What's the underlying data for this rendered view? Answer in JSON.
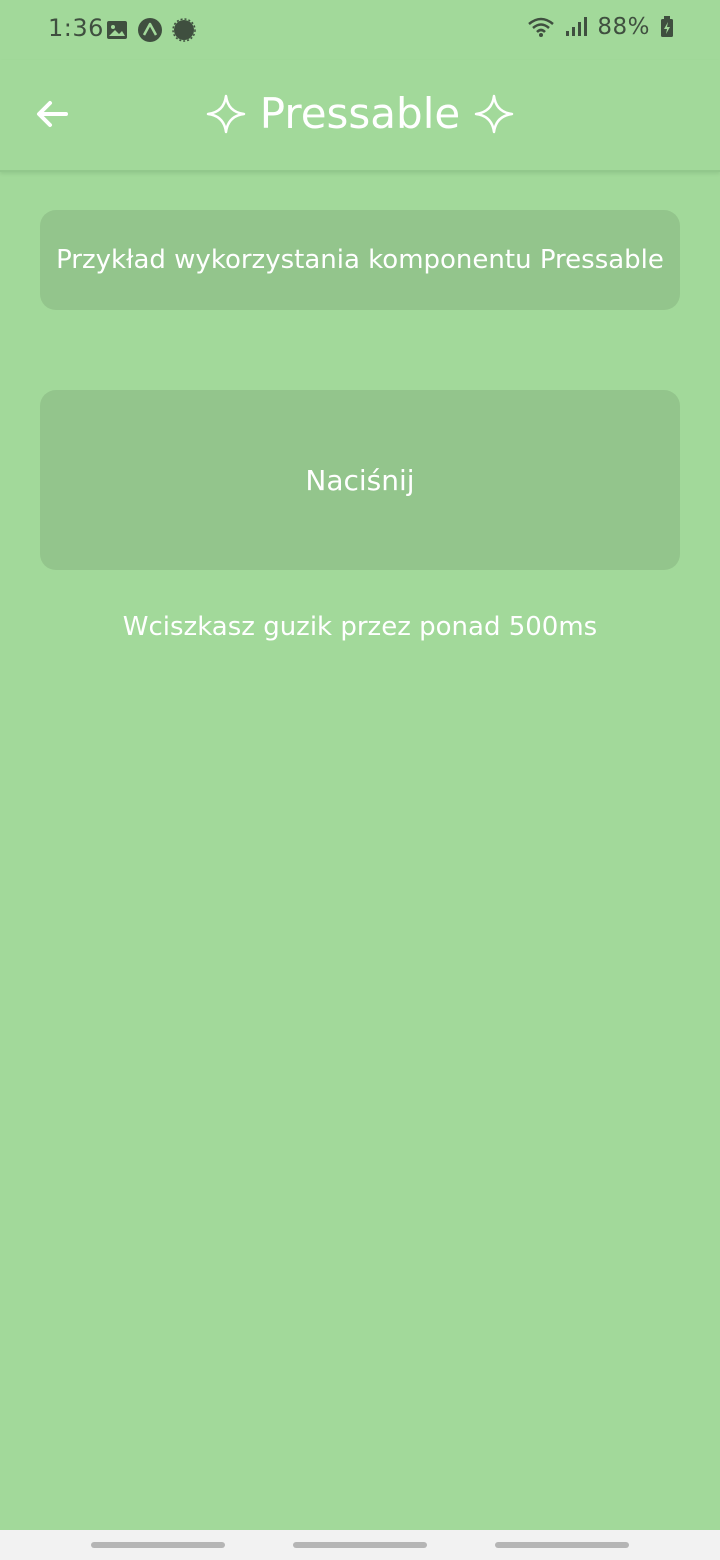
{
  "status_bar": {
    "time": "1:36",
    "battery": "88%",
    "icons": [
      "image-icon",
      "expo-icon",
      "signal-app-icon",
      "wifi-icon",
      "cell-signal-icon",
      "battery-charging-icon"
    ]
  },
  "header": {
    "title": "Pressable",
    "back_icon": "arrow-left-icon",
    "decoration_icon": "sparkle-icon"
  },
  "main": {
    "info_text": "Przykład wykorzystania komponentu Pressable",
    "button_label": "Naciśnij",
    "status_text": "Wciszkasz guzik przez ponad 500ms"
  },
  "colors": {
    "background": "#a2d99a",
    "card": "#93c58c",
    "text": "#ffffff",
    "status_icons": "#3f4f3f"
  }
}
